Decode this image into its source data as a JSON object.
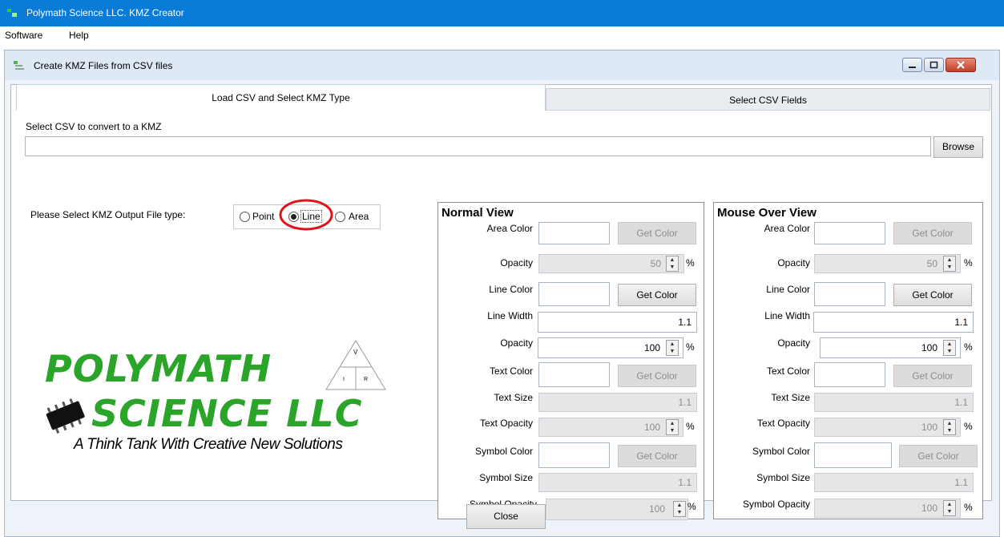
{
  "app": {
    "title": "Polymath Science LLC. KMZ Creator"
  },
  "menu": {
    "items": [
      "Software",
      "Help"
    ]
  },
  "window": {
    "title": "Create KMZ Files from CSV files"
  },
  "tabs": [
    "Load CSV and Select KMZ Type",
    "Select CSV Fields"
  ],
  "csv": {
    "label": "Select CSV to convert to a KMZ",
    "value": "",
    "browse": "Browse"
  },
  "type": {
    "label": "Please Select KMZ Output File type:",
    "options": [
      "Point",
      "Line",
      "Area"
    ],
    "selected": "Line"
  },
  "logo": {
    "line1": "POLYMATH",
    "line2": "SCIENCE LLC",
    "tagline": "A Think Tank With Creative New Solutions",
    "tri_top": "V",
    "tri_left": "I",
    "tri_right": "R"
  },
  "normal": {
    "title": "Normal View",
    "area_color": "Area Color",
    "opacity": "Opacity",
    "line_color": "Line Color",
    "line_width": "Line Width",
    "text_color": "Text Color",
    "text_size": "Text Size",
    "text_opacity": "Text Opacity",
    "symbol_color": "Symbol Color",
    "symbol_size": "Symbol Size",
    "symbol_opacity": "Symbol Opacity",
    "get_color": "Get Color",
    "area_opacity_val": "50",
    "line_width_val": "1.1",
    "line_opacity_val": "100",
    "text_size_val": "1.1",
    "text_opacity_val": "100",
    "symbol_size_val": "1.1",
    "symbol_opacity_val": "100",
    "pct": "%"
  },
  "mouse": {
    "title": "Mouse Over View",
    "area_color": "Area Color",
    "opacity": "Opacity",
    "line_color": "Line Color",
    "line_width": "Line Width",
    "text_color": "Text Color",
    "text_size": "Text Size",
    "text_opacity": "Text Opacity",
    "symbol_color": "Symbol Color",
    "symbol_size": "Symbol Size",
    "symbol_opacity": "Symbol Opacity",
    "get_color": "Get Color",
    "area_opacity_val": "50",
    "line_width_val": "1.1",
    "line_opacity_val": "100",
    "text_size_val": "1.1",
    "text_opacity_val": "100",
    "symbol_size_val": "1.1",
    "symbol_opacity_val": "100",
    "pct": "%"
  },
  "footer": {
    "close": "Close"
  },
  "colors": {
    "titlebar": "#0a7bd6",
    "logo_green": "#2aa52a",
    "highlight": "#e0141b"
  }
}
